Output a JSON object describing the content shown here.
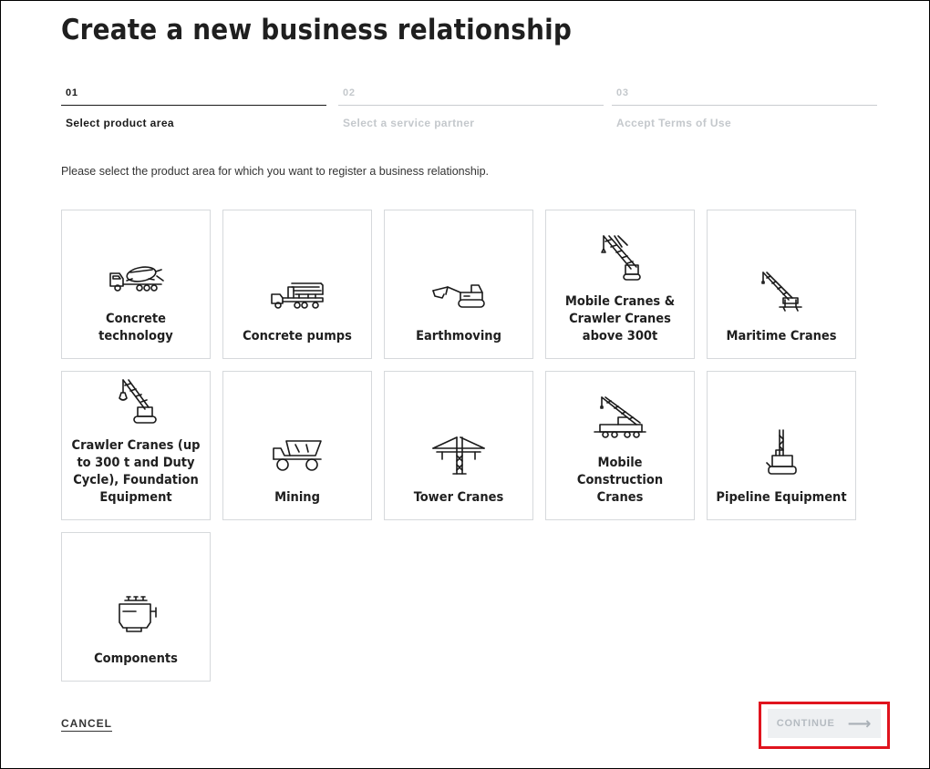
{
  "page": {
    "title": "Create a new business relationship",
    "intro": "Please select the product area for which you want to register a business relationship."
  },
  "steps": [
    {
      "number": "01",
      "label": "Select product area",
      "active": true
    },
    {
      "number": "02",
      "label": "Select a service partner",
      "active": false
    },
    {
      "number": "03",
      "label": "Accept Terms of Use",
      "active": false
    }
  ],
  "product_areas": [
    {
      "label": "Concrete technology",
      "icon": "concrete-mixer-truck-icon"
    },
    {
      "label": "Concrete pumps",
      "icon": "concrete-pump-truck-icon"
    },
    {
      "label": "Earthmoving",
      "icon": "excavator-icon"
    },
    {
      "label": "Mobile Cranes & Crawler Cranes above 300t",
      "icon": "lattice-crane-icon"
    },
    {
      "label": "Maritime Cranes",
      "icon": "maritime-crane-icon"
    },
    {
      "label": "Crawler Cranes (up to 300 t and Duty Cycle), Foundation Equipment",
      "icon": "crawler-crane-icon"
    },
    {
      "label": "Mining",
      "icon": "mining-truck-icon"
    },
    {
      "label": "Tower Cranes",
      "icon": "tower-crane-icon"
    },
    {
      "label": "Mobile Construction Cranes",
      "icon": "mobile-construction-crane-icon"
    },
    {
      "label": "Pipeline Equipment",
      "icon": "pipelayer-icon"
    },
    {
      "label": "Components",
      "icon": "engine-icon"
    }
  ],
  "actions": {
    "cancel": "CANCEL",
    "continue": "CONTINUE",
    "continue_icon": "arrow-right-icon",
    "continue_enabled": false,
    "highlight_color": "#e0141e"
  }
}
